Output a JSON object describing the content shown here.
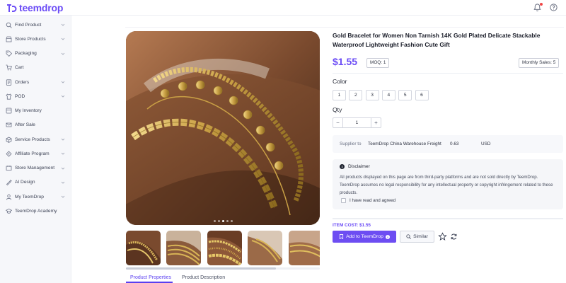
{
  "brand": {
    "name": "teemdrop",
    "accent": "#6b4cf6"
  },
  "topbar": {
    "icons": [
      "bell-icon",
      "help-icon"
    ]
  },
  "sidebar": {
    "items": [
      {
        "label": "Find Product",
        "icon": "search-icon",
        "expandable": true
      },
      {
        "label": "Store Products",
        "icon": "store-icon",
        "expandable": true
      },
      {
        "label": "Packaging",
        "icon": "tag-icon",
        "expandable": true
      },
      {
        "label": "Cart",
        "icon": "cart-icon",
        "expandable": false
      },
      {
        "label": "Orders",
        "icon": "orders-icon",
        "expandable": true
      },
      {
        "label": "POD",
        "icon": "pod-icon",
        "expandable": true
      },
      {
        "label": "My Inventory",
        "icon": "inventory-icon",
        "expandable": false
      },
      {
        "label": "After Sale",
        "icon": "after-sale-icon",
        "expandable": false
      },
      {
        "label": "Service Products",
        "icon": "service-icon",
        "expandable": true
      },
      {
        "label": "Affiliate Program",
        "icon": "affiliate-icon",
        "expandable": true
      },
      {
        "label": "Store Management",
        "icon": "store-management-icon",
        "expandable": true
      },
      {
        "label": "AI Design",
        "icon": "ai-design-icon",
        "expandable": true
      },
      {
        "label": "My TeemDrop",
        "icon": "user-icon",
        "expandable": true
      },
      {
        "label": "TeemDrop Academy",
        "icon": "academy-icon",
        "expandable": false
      }
    ]
  },
  "product": {
    "title": "Gold Bracelet for Women Non Tarnish 14K Gold Plated Delicate Stackable Waterproof Lightweight Fashion Cute Gift",
    "price": "$1.55",
    "moq": "MOQ: 1",
    "monthly_sales": "Monthly Sales: 5",
    "color_label": "Color",
    "color_options": [
      "1",
      "2",
      "3",
      "4",
      "5",
      "6"
    ],
    "qty_label": "Qty",
    "qty_value": "1",
    "qty_minus": "−",
    "qty_plus": "+",
    "image_count": 5,
    "active_image": 3
  },
  "shipping": {
    "supplier_label": "Supplier to",
    "value": "TeemDrop China Warehouse Freight",
    "price": "0.63",
    "currency": "USD"
  },
  "disclaimer": {
    "title": "Disclaimer",
    "text": "All products displayed on this page are from third-party platforms and are not sold directly by TeemDrop. TeemDrop assumes no legal responsibility for any intellectual property or copyright infringement related to these products.",
    "checkbox_label": "I have read and agreed",
    "checked": false
  },
  "actions": {
    "item_cost": "ITEM COST:  $1.55",
    "add_button": "Add to TeemDrop",
    "similar_button": "Similar"
  },
  "tabs": [
    {
      "label": "Product Properties",
      "active": true
    },
    {
      "label": "Product Description",
      "active": false
    }
  ]
}
